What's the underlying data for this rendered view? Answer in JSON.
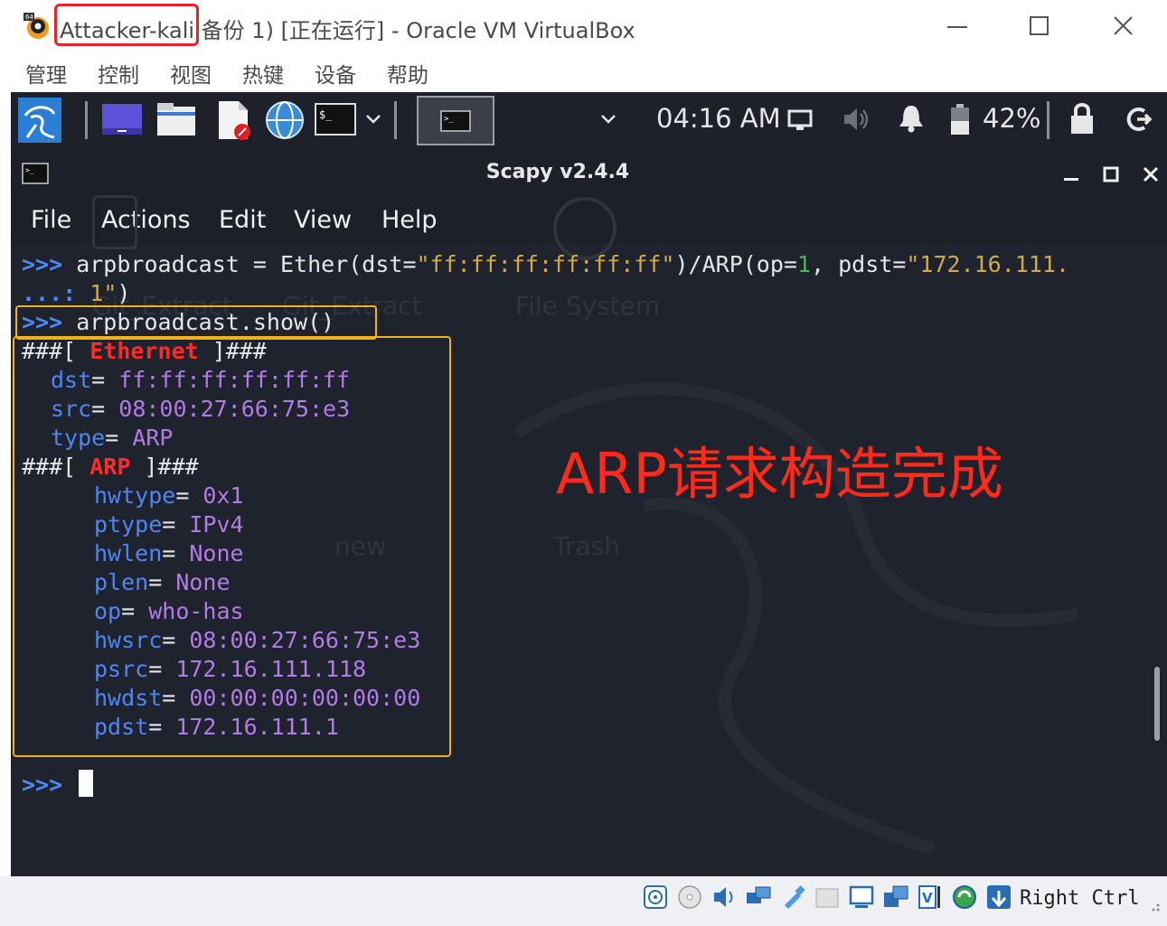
{
  "window": {
    "vm_name": "Attacker-kali",
    "title_rest": " 备份 1) [正在运行] - Oracle VM VirtualBox"
  },
  "vb_menu": [
    "管理",
    "控制",
    "视图",
    "热键",
    "设备",
    "帮助"
  ],
  "panel": {
    "clock": "04:16 AM",
    "battery": "42%"
  },
  "terminal": {
    "title": "Scapy v2.4.4",
    "menu": [
      "File",
      "Actions",
      "Edit",
      "View",
      "Help"
    ],
    "prompt": ">>>",
    "continuation": "...:",
    "cmd1_a": " arpbroadcast = Ether(dst=",
    "cmd1_dst": "\"ff:ff:ff:ff:ff:ff\"",
    "cmd1_b": ")/ARP(op=",
    "cmd1_op": "1",
    "cmd1_c": ", pdst=",
    "cmd1_pdst_a": "\"172.16.111.",
    "cmd1_pdst_b": " 1\"",
    "cmd1_end": ")",
    "cmd2": " arpbroadcast.show()",
    "hdr_open": "###[ ",
    "hdr_close": " ]###",
    "eth_layer": "Ethernet",
    "eth_fields": [
      {
        "name": "dst",
        "value": "ff:ff:ff:ff:ff:ff"
      },
      {
        "name": "src",
        "value": "08:00:27:66:75:e3"
      },
      {
        "name": "type",
        "value": "ARP"
      }
    ],
    "arp_layer": "ARP",
    "arp_fields": [
      {
        "name": "hwtype",
        "value": "0x1"
      },
      {
        "name": "ptype",
        "value": "IPv4"
      },
      {
        "name": "hwlen",
        "value": "None"
      },
      {
        "name": "plen",
        "value": "None"
      },
      {
        "name": "op",
        "value": "who-has"
      },
      {
        "name": "hwsrc",
        "value": "08:00:27:66:75:e3"
      },
      {
        "name": "psrc",
        "value": "172.16.111.118"
      },
      {
        "name": "hwdst",
        "value": "00:00:00:00:00:00"
      },
      {
        "name": "pdst",
        "value": "172.16.111.1"
      }
    ]
  },
  "desktop_ghosts": [
    "Git_Extract",
    "File System",
    "new",
    "Trash"
  ],
  "annotation": "ARP请求构造完成",
  "statusbar": {
    "host_key": "Right Ctrl"
  }
}
